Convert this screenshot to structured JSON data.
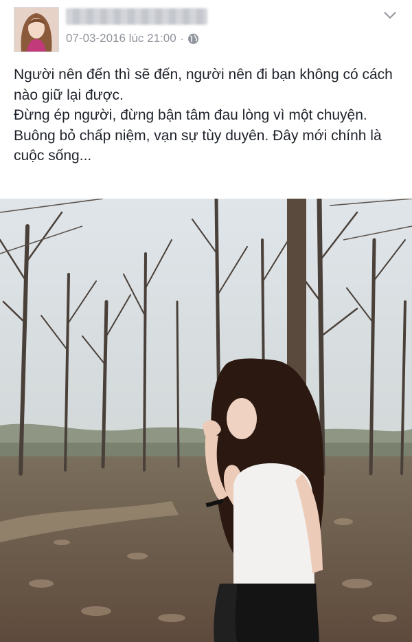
{
  "post": {
    "timestamp": "07-03-2016 lúc 21:00",
    "separator": "·",
    "privacy_icon": "globe-icon",
    "menu_icon": "chevron-down-icon",
    "avatar_icon": "profile-avatar",
    "lines": [
      "Người nên đến thì sẽ đến, người nên đi bạn không có cách nào giữ lại được.",
      "Đừng ép người, đừng bận tâm đau lòng vì một chuyện.",
      "Buông bỏ chấp niệm, vạn sự tùy duyên. Đây mới chính là cuộc sống..."
    ]
  },
  "colors": {
    "text": "#1d2129",
    "meta": "#90949c",
    "sky": "#d7dde2",
    "ground": "#6e5a4a",
    "hair": "#2b1810",
    "top": "#f2f1ef"
  }
}
